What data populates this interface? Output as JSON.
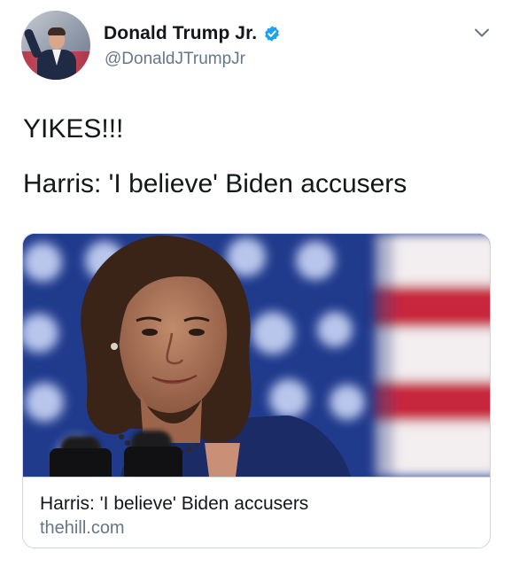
{
  "author": {
    "display_name": "Donald Trump Jr.",
    "handle": "@DonaldJTrumpJr",
    "verified": true
  },
  "tweet": {
    "text_line1": "YIKES!!!",
    "text_line2": "Harris: 'I believe' Biden accusers"
  },
  "card": {
    "title": "Harris: 'I believe' Biden accusers",
    "domain": "thehill.com"
  },
  "colors": {
    "verified_blue": "#1da1f2",
    "secondary_text": "#657786",
    "border": "#ccd6dd"
  },
  "icons": {
    "verified": "verified-badge-icon",
    "menu": "chevron-down-icon"
  }
}
